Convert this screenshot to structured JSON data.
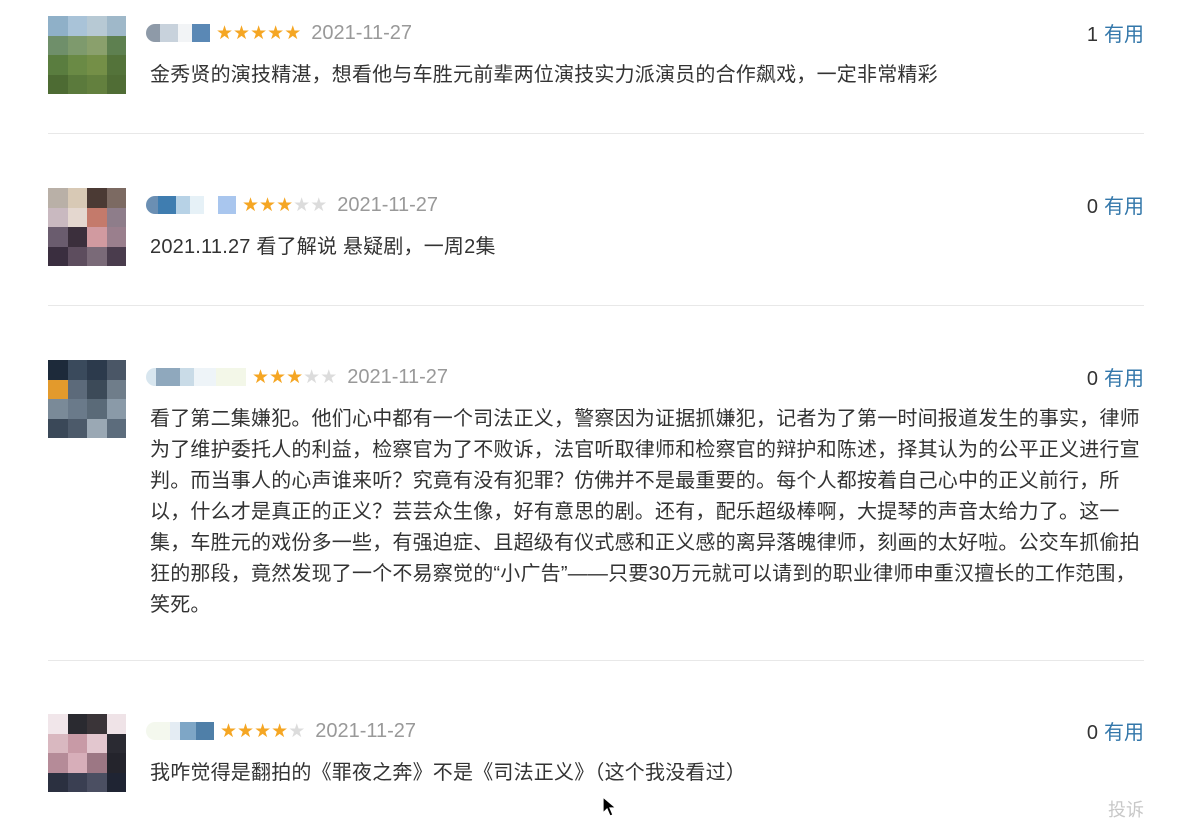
{
  "reviews": [
    {
      "rating": 5,
      "date": "2021-11-27",
      "helpful_count": "1",
      "helpful_label": "有用",
      "content": "金秀贤的演技精湛，想看他与车胜元前辈两位演技实力派演员的合作飙戏，一定非常精彩",
      "avatar_colors": [
        "#8fb0c8",
        "#a9c3d8",
        "#b7c9d4",
        "#9fb8c9",
        "#6f8f6a",
        "#7e9a6d",
        "#8aa06c",
        "#5e8050",
        "#5a7d3f",
        "#6a8a45",
        "#748f47",
        "#54733a",
        "#4d6b33",
        "#5b7a3c",
        "#63803e",
        "#506d35"
      ],
      "name_colors": [
        "#8e9aa8",
        "#c8d2dc",
        "#f2f4f6",
        "#5a88b5"
      ]
    },
    {
      "rating": 3,
      "date": "2021-11-27",
      "helpful_count": "0",
      "helpful_label": "有用",
      "content": "2021.11.27 看了解说 悬疑剧，一周2集",
      "avatar_colors": [
        "#b9b0a7",
        "#d8c9b5",
        "#4b3a34",
        "#7c6a62",
        "#c9b9c0",
        "#e4d7cf",
        "#c47a6b",
        "#8e7d8a",
        "#6a5c6e",
        "#3b2f3c",
        "#d19aa0",
        "#9a7f8d",
        "#3a2e3f",
        "#5d4d5e",
        "#7a6a78",
        "#4a3c4d"
      ],
      "name_colors": [
        "#6b8fb3",
        "#3f7db0",
        "#b7d2e6",
        "#e6f1f7",
        "#ffffff",
        "#a9c6ee"
      ]
    },
    {
      "rating": 3,
      "date": "2021-11-27",
      "helpful_count": "0",
      "helpful_label": "有用",
      "content": "看了第二集嫌犯。他们心中都有一个司法正义，警察因为证据抓嫌犯，记者为了第一时间报道发生的事实，律师为了维护委托人的利益，检察官为了不败诉，法官听取律师和检察官的辩护和陈述，择其认为的公平正义进行宣判。而当事人的心声谁来听？究竟有没有犯罪？仿佛并不是最重要的。每个人都按着自己心中的正义前行，所以，什么才是真正的正义？芸芸众生像，好有意思的剧。还有，配乐超级棒啊，大提琴的声音太给力了。这一集，车胜元的戏份多一些，有强迫症、且超级有仪式感和正义感的离异落魄律师，刻画的太好啦。公交车抓偷拍狂的那段，竟然发现了一个不易察觉的“小广告”——只要30万元就可以请到的职业律师申重汉擅长的工作范围，笑死。",
      "avatar_colors": [
        "#1d2a3a",
        "#3a4a5c",
        "#2c3a4c",
        "#4a5666",
        "#e39a2c",
        "#5c6a7a",
        "#3c4a58",
        "#6f7d8a",
        "#7a8a98",
        "#6a7a8a",
        "#5a6a78",
        "#8a9aa8",
        "#3a4858",
        "#4c5a6a",
        "#9aa8b4",
        "#5c6c7c"
      ],
      "name_colors": [
        "#d8e6ef",
        "#8fa8bd",
        "#c9dbe7",
        "#eef4f8",
        "#f3f7e8"
      ]
    },
    {
      "rating": 4,
      "date": "2021-11-27",
      "helpful_count": "0",
      "helpful_label": "有用",
      "content": "我咋觉得是翻拍的《罪夜之奔》不是《司法正义》（这个我没看过）",
      "avatar_colors": [
        "#f1e6ea",
        "#2a2a30",
        "#3a3438",
        "#efe3e7",
        "#d9b8c0",
        "#c89aa6",
        "#e3c7cf",
        "#2a2a32",
        "#b58b98",
        "#d7aeb9",
        "#9c7784",
        "#24242c",
        "#2b3040",
        "#3a3f52",
        "#4b4f62",
        "#1f2433"
      ],
      "name_colors": [
        "#f4f8ee",
        "#e4ecf3",
        "#7ea6c6",
        "#4f7fa8"
      ]
    }
  ],
  "footer": {
    "report_label": "投诉"
  },
  "icons": {
    "star_full": "★",
    "star_empty": "★",
    "cursor": "arrow-cursor-icon"
  }
}
